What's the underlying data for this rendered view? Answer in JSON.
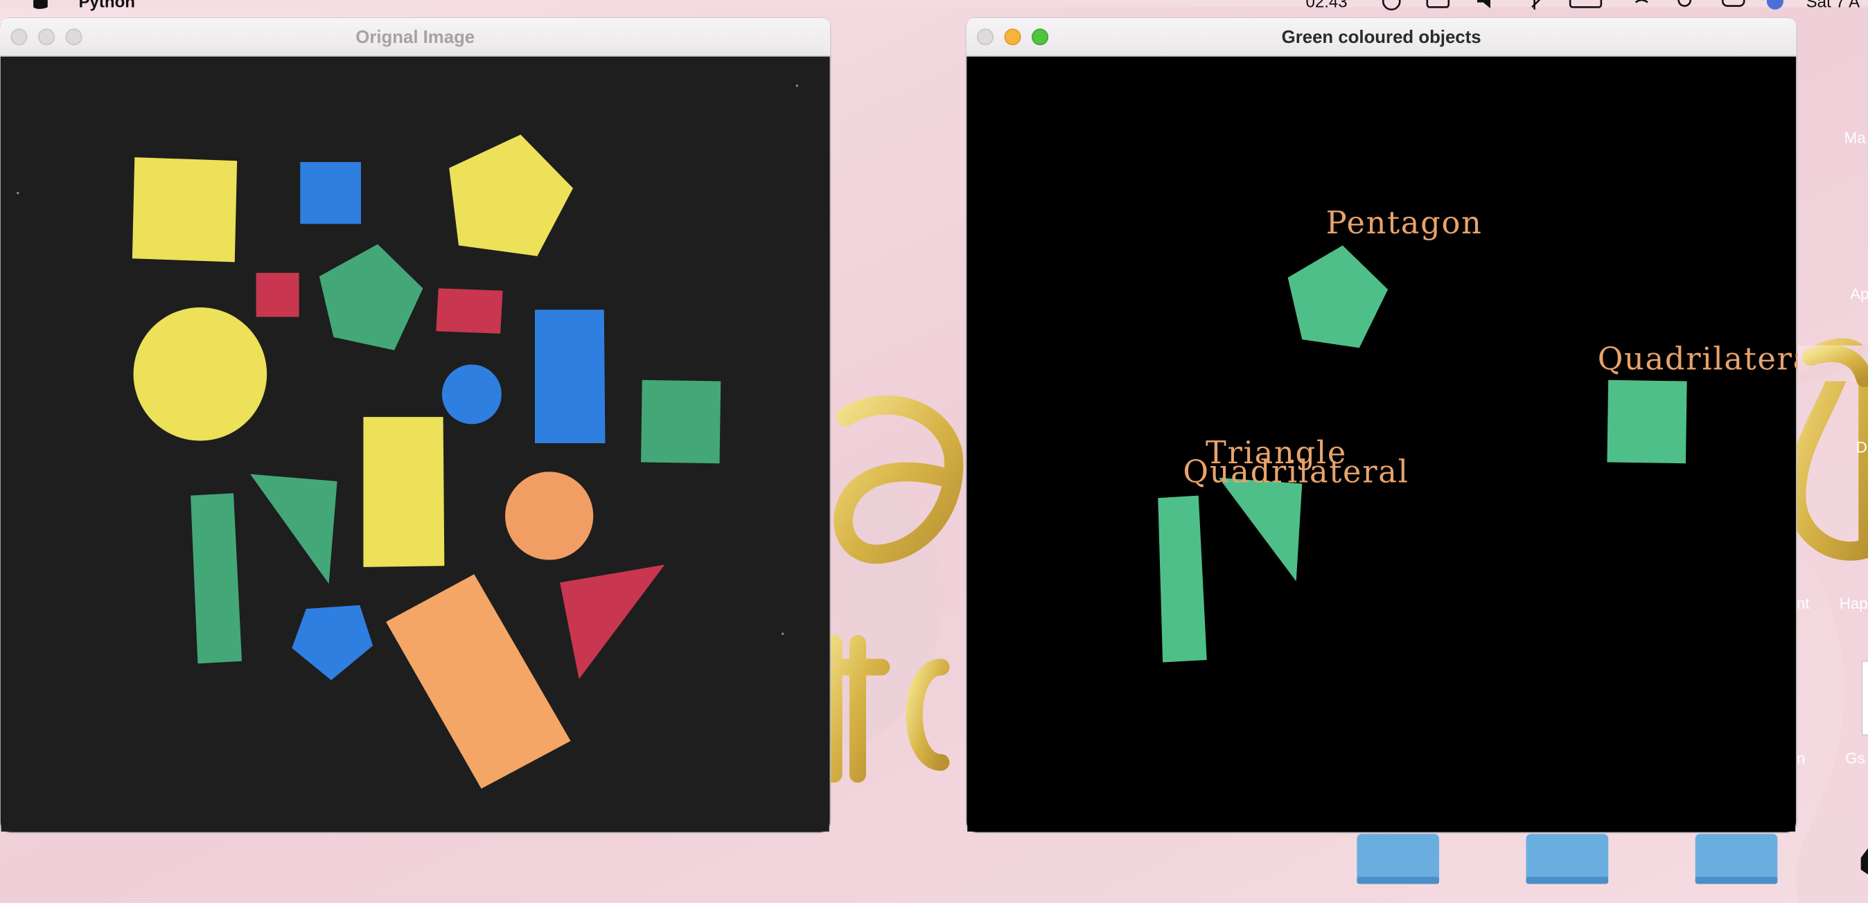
{
  "menubar": {
    "app_name": "Python",
    "clock": "02:43",
    "date": "Sat 7 A"
  },
  "windows": {
    "original": {
      "title": "Orignal Image"
    },
    "green": {
      "title": "Green coloured objects",
      "labels": {
        "pentagon": "Pentagon",
        "quadrilateral_right": "Quadrilateral",
        "triangle": "Triangle",
        "quadrilateral_left": "Quadrilateral"
      }
    }
  },
  "desktop": {
    "icon_labels": [
      "Ma",
      "Ap",
      "D",
      "nt",
      "Hap",
      "n",
      "Gs"
    ]
  },
  "colors": {
    "yellow": "#ece159",
    "blue": "#2f7fe0",
    "red": "#c8374f",
    "green": "#44a778",
    "orange": "#f19e64",
    "mask_green": "#4fbf8a",
    "label": "#e9a36b",
    "wallpaper": "#f3d8df"
  }
}
